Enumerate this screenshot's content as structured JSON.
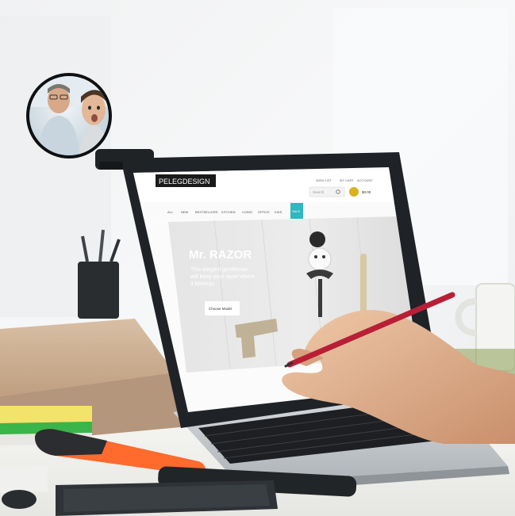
{
  "scene": {
    "palette": {
      "background_light": "#f4f5f6",
      "window_glow": "#eef0f2",
      "desk": "#f5f4f0",
      "wood_shelf": "#c9a887",
      "laptop_frame": "#1f2226",
      "laptop_base": "#cfd3d6",
      "screen_bg": "#fbfbfb",
      "hero_bg": "#e7e7e7",
      "accent_teal": "#2fb7c2",
      "pen_red": "#c2243a",
      "highlighter_orange": "#ff6a2d",
      "sticky_yellow": "#f2e36a",
      "sticky_green": "#39b54a",
      "mirror_rim": "#111214",
      "mirror_sky": "#dfe9ef"
    }
  },
  "website": {
    "logo": "PELEGDESIGN",
    "header_links": [
      "WISH LIST",
      "MY CART",
      "ACCOUNT"
    ],
    "search_placeholder": "Search",
    "cart_label": "$0.00",
    "nav_items": [
      "ALL",
      "NEW",
      "BESTSELLERS",
      "KITCHEN",
      "LIVING",
      "OFFICE",
      "KIDS",
      "SALE"
    ],
    "hero": {
      "title": "Mr. RAZOR",
      "subtitle_line1": "This elegant gentleman",
      "subtitle_line2": "will keep your razor where",
      "subtitle_line3": "it belongs.",
      "cta": "Choose Model"
    }
  }
}
